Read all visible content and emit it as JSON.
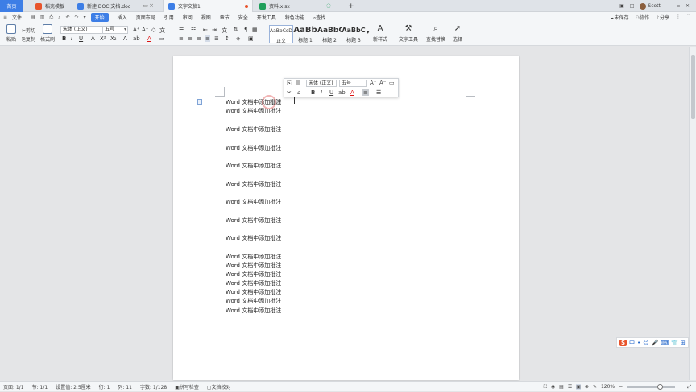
{
  "tabs": [
    {
      "label": "首页",
      "color": "#3d7ee6"
    },
    {
      "label": "稻壳模板",
      "color": "#e8542c"
    },
    {
      "label": "新建 DOC 文档.doc",
      "color": "#3d7ee6"
    },
    {
      "label": "文字文稿1",
      "color": "#3d7ee6"
    },
    {
      "label": "资料.xlsx",
      "color": "#1e9e5a"
    }
  ],
  "topright": {
    "user": "Scott",
    "badge": "1"
  },
  "menu": {
    "file": "文件",
    "start": "开始",
    "items": [
      "插入",
      "页面布局",
      "引用",
      "审阅",
      "视图",
      "章节",
      "安全",
      "开发工具",
      "特色功能"
    ],
    "search": "查找",
    "right": [
      "未保存",
      "协作",
      "分享"
    ]
  },
  "ribbon": {
    "paste": "粘贴",
    "cut": "剪切",
    "copy": "复制",
    "format_painter": "格式刷",
    "font_name": "宋体 (正文)",
    "font_size": "五号",
    "styles": [
      {
        "preview": "AaBbCcDd",
        "label": "正文"
      },
      {
        "preview": "AaBb",
        "label": "标题 1"
      },
      {
        "preview": "AaBbC",
        "label": "标题 2"
      },
      {
        "preview": "AaBbC",
        "label": "标题 3"
      }
    ],
    "new_style": "新样式",
    "text_tools": "文字工具",
    "find_replace": "查找替换",
    "select": "选择"
  },
  "document": {
    "lines": [
      "Word 文档中添加批注",
      "Word 文档中添加批注",
      "Word 文档中添加批注",
      "Word 文档中添加批注",
      "Word 文档中添加批注",
      "Word 文档中添加批注",
      "Word 文档中添加批注",
      "Word 文档中添加批注",
      "Word 文档中添加批注",
      "Word 文档中添加批注",
      "Word 文档中添加批注",
      "Word 文档中添加批注",
      "Word 文档中添加批注",
      "Word 文档中添加批注",
      "Word 文档中添加批注",
      "Word 文档中添加批注"
    ],
    "selected_text": "批注"
  },
  "minibar": {
    "font_name": "宋体 (正文)",
    "font_size": "五号"
  },
  "statusbar": {
    "page": "页面: 1/1",
    "section": "节: 1/1",
    "setting": "设置值: 2.5厘米",
    "row": "行: 1",
    "col": "列: 11",
    "words": "字数: 1/128",
    "spell": "拼写检查",
    "proof": "文档校对",
    "zoom": "120%"
  },
  "ime": [
    "中",
    "•",
    "☺",
    "🎤",
    "⌨",
    "👕",
    "⊞"
  ]
}
